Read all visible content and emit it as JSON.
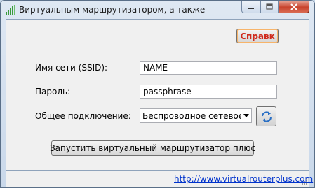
{
  "window": {
    "title": "Виртуальным маршрутизатором, а также",
    "app_icon": "signal-bars-icon"
  },
  "toolbar": {
    "help_label": "Справк"
  },
  "form": {
    "ssid_label": "Имя сети (SSID):",
    "ssid_value": "NAME",
    "password_label": "Пароль:",
    "password_value": "passphrase",
    "shared_label": "Общее подключение:",
    "shared_value": "Беспроводное сетевое сое,",
    "refresh_icon": "refresh-icon"
  },
  "actions": {
    "start_label": "Запустить виртуальный маршрутизатор плюс"
  },
  "status": {
    "link_text": "http://www.virtualrouterplus.com"
  },
  "colors": {
    "help_text": "#d02a1c",
    "link": "#0033cc",
    "close_button": "#c8432c"
  }
}
